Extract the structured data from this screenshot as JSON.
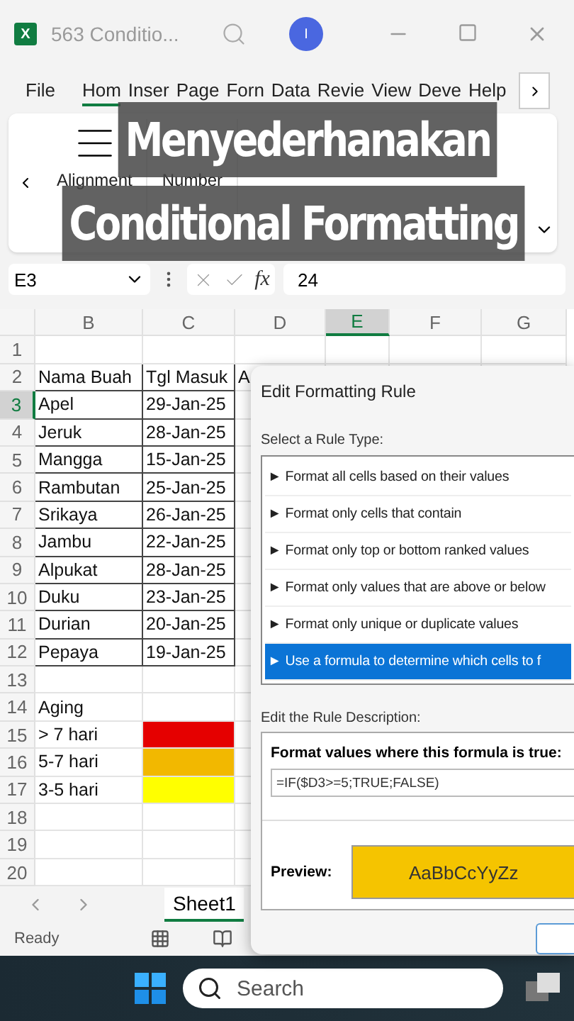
{
  "window": {
    "app_icon": "X",
    "title": "563 Conditio...",
    "avatar": "I"
  },
  "tabs": [
    {
      "label": "File",
      "selected": false
    },
    {
      "label": "Hom",
      "selected": true
    },
    {
      "label": "Inser",
      "selected": false
    },
    {
      "label": "Page",
      "selected": false
    },
    {
      "label": "Forn",
      "selected": false
    },
    {
      "label": "Data",
      "selected": false
    },
    {
      "label": "Revie",
      "selected": false
    },
    {
      "label": "View",
      "selected": false
    },
    {
      "label": "Deve",
      "selected": false
    },
    {
      "label": "Help",
      "selected": false
    }
  ],
  "ribbon": {
    "groups": [
      "Alignment",
      "Number"
    ]
  },
  "caption": [
    "Menyederhanakan",
    "Conditional Formatting"
  ],
  "formula_bar": {
    "name_box": "E3",
    "fx": "fx",
    "value": "24"
  },
  "columns": [
    {
      "label": "B",
      "selected": false
    },
    {
      "label": "C",
      "selected": false
    },
    {
      "label": "D",
      "selected": false
    },
    {
      "label": "E",
      "selected": true
    },
    {
      "label": "F",
      "selected": false
    },
    {
      "label": "G",
      "selected": false
    }
  ],
  "rows": [
    {
      "number": "1",
      "selected": false,
      "boxed": false
    },
    {
      "number": "2",
      "selected": false,
      "boxed": true,
      "b": "Nama Buah",
      "c": "Tgl Masuk",
      "d": "A"
    },
    {
      "number": "3",
      "selected": true,
      "boxed": true,
      "b": "Apel",
      "c": "29-Jan-25"
    },
    {
      "number": "4",
      "selected": false,
      "boxed": true,
      "b": "Jeruk",
      "c": "28-Jan-25"
    },
    {
      "number": "5",
      "selected": false,
      "boxed": true,
      "b": "Mangga",
      "c": "15-Jan-25"
    },
    {
      "number": "6",
      "selected": false,
      "boxed": true,
      "b": "Rambutan",
      "c": "25-Jan-25"
    },
    {
      "number": "7",
      "selected": false,
      "boxed": true,
      "b": "Srikaya",
      "c": "26-Jan-25"
    },
    {
      "number": "8",
      "selected": false,
      "boxed": true,
      "b": "Jambu",
      "c": "22-Jan-25"
    },
    {
      "number": "9",
      "selected": false,
      "boxed": true,
      "b": "Alpukat",
      "c": "28-Jan-25"
    },
    {
      "number": "10",
      "selected": false,
      "boxed": true,
      "b": "Duku",
      "c": "23-Jan-25"
    },
    {
      "number": "11",
      "selected": false,
      "boxed": true,
      "b": "Durian",
      "c": "20-Jan-25"
    },
    {
      "number": "12",
      "selected": false,
      "boxed": true,
      "b": "Pepaya",
      "c": "19-Jan-25"
    },
    {
      "number": "13",
      "selected": false,
      "boxed": false
    },
    {
      "number": "14",
      "selected": false,
      "boxed": false,
      "b": "Aging"
    },
    {
      "number": "15",
      "selected": false,
      "boxed": false,
      "b": "> 7 hari",
      "color": "#e50000"
    },
    {
      "number": "16",
      "selected": false,
      "boxed": false,
      "b": "5-7 hari",
      "color": "#f2b800"
    },
    {
      "number": "17",
      "selected": false,
      "boxed": false,
      "b": "3-5 hari",
      "color": "#ffff00"
    },
    {
      "number": "18",
      "selected": false,
      "boxed": false
    },
    {
      "number": "19",
      "selected": false,
      "boxed": false
    },
    {
      "number": "20",
      "selected": false,
      "boxed": false
    }
  ],
  "sheet_tabs": [
    {
      "label": "Sheet1",
      "selected": true
    }
  ],
  "status_bar": {
    "text": "Ready"
  },
  "dialog": {
    "title": "Edit Formatting Rule",
    "select_label": "Select a Rule Type:",
    "rule_types": [
      {
        "label": "Format all cells based on their values",
        "selected": false
      },
      {
        "label": "Format only cells that contain",
        "selected": false
      },
      {
        "label": "Format only top or bottom ranked values",
        "selected": false
      },
      {
        "label": "Format only values that are above or below",
        "selected": false
      },
      {
        "label": "Format only unique or duplicate values",
        "selected": false
      },
      {
        "label": "Use a formula to determine which cells to f",
        "selected": true
      }
    ],
    "description_label": "Edit the Rule Description:",
    "formula_label": "Format values where this formula is true:",
    "formula": "=IF($D3>=5;TRUE;FALSE)",
    "preview_label": "Preview:",
    "preview_text": "AaBbCcYyZz",
    "marker": "►"
  },
  "taskbar": {
    "search_placeholder": "Search"
  }
}
